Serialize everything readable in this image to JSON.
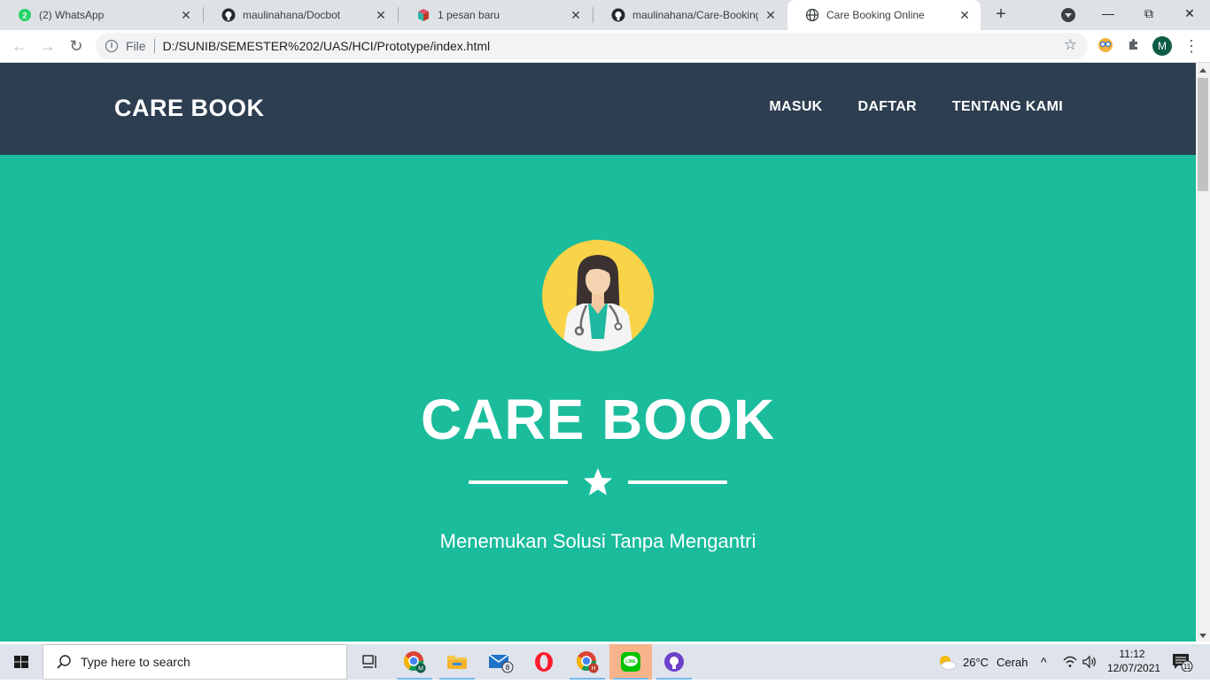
{
  "browser": {
    "tabs": [
      {
        "title": "(2) WhatsApp",
        "icon": "whatsapp-icon",
        "active": false
      },
      {
        "title": "maulinahana/Docbot",
        "icon": "github-icon",
        "active": false
      },
      {
        "title": "1 pesan baru",
        "icon": "book-icon",
        "active": false
      },
      {
        "title": "maulinahana/Care-Booking-O",
        "icon": "github-icon",
        "active": false
      },
      {
        "title": "Care Booking Online",
        "icon": "globe-icon",
        "active": true
      }
    ],
    "whatsapp_badge": "2",
    "address": {
      "scheme": "File",
      "url": "D:/SUNIB/SEMESTER%202/UAS/HCI/Prototype/index.html"
    },
    "profile_initial": "M"
  },
  "site": {
    "brand": "CARE BOOK",
    "nav": [
      "MASUK",
      "DAFTAR",
      "TENTANG KAMI"
    ],
    "hero": {
      "title": "CARE BOOK",
      "subtitle": "Menemukan Solusi Tanpa Mengantri"
    },
    "colors": {
      "navbar": "#2c3e50",
      "masthead": "#1abc9c",
      "avatar_bg": "#f9d348"
    }
  },
  "taskbar": {
    "search_placeholder": "Type here to search",
    "mail_badge": "8",
    "weather_temp": "26°C",
    "weather_text": "Cerah",
    "time": "11:12",
    "date": "12/07/2021",
    "notification_count": "11",
    "apps": [
      "chrome-profile-m-icon",
      "file-explorer-icon",
      "mail-icon",
      "opera-icon",
      "chrome-profile-h-icon",
      "line-icon",
      "github-desktop-icon"
    ]
  }
}
